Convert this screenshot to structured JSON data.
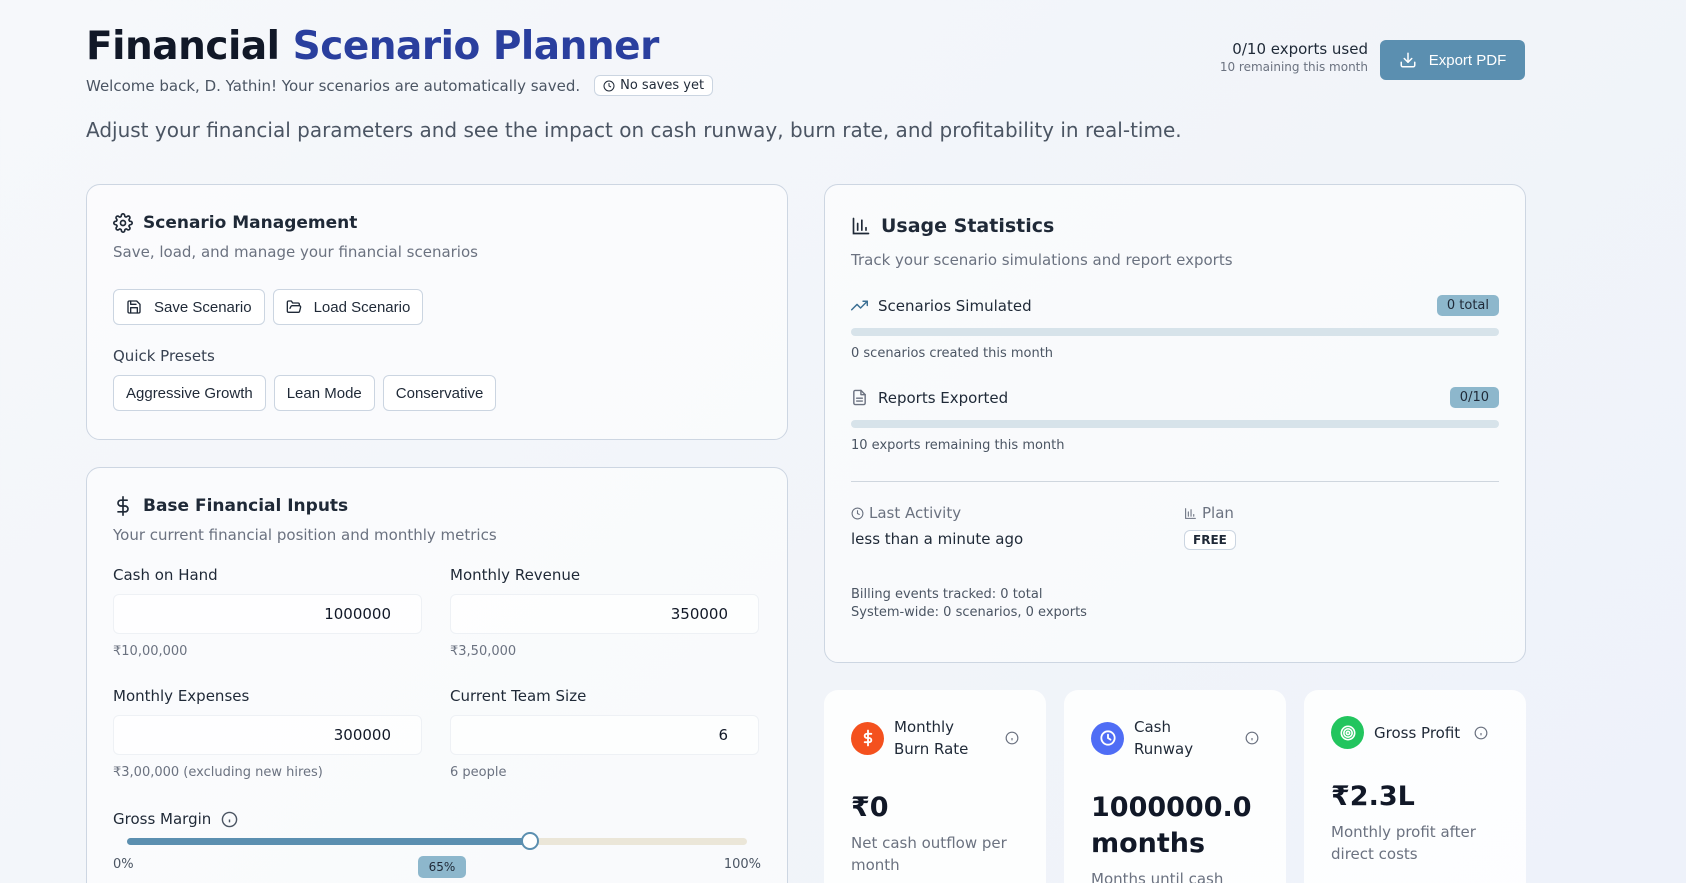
{
  "header": {
    "title_part1": "Financial",
    "title_part2": "Scenario Planner",
    "welcome": "Welcome back, D. Yathin! Your scenarios are automatically saved.",
    "save_status": "No saves yet",
    "lead": "Adjust your financial parameters and see the impact on cash runway, burn rate, and profitability in real-time.",
    "exports_used": "0/10 exports used",
    "exports_remaining": "10 remaining this month",
    "export_button": "Export PDF"
  },
  "scenario": {
    "title": "Scenario Management",
    "desc": "Save, load, and manage your financial scenarios",
    "save_button": "Save Scenario",
    "load_button": "Load Scenario",
    "presets_label": "Quick Presets",
    "presets": [
      "Aggressive Growth",
      "Lean Mode",
      "Conservative"
    ]
  },
  "base_inputs": {
    "title": "Base Financial Inputs",
    "desc": "Your current financial position and monthly metrics",
    "cash": {
      "label": "Cash on Hand",
      "value": "1000000",
      "note": "₹10,00,000"
    },
    "revenue": {
      "label": "Monthly Revenue",
      "value": "350000",
      "note": "₹3,50,000"
    },
    "expenses": {
      "label": "Monthly Expenses",
      "value": "300000",
      "note": "₹3,00,000 (excluding new hires)"
    },
    "team": {
      "label": "Current Team Size",
      "value": "6",
      "note": "6 people"
    },
    "gross_margin": {
      "label": "Gross Margin",
      "min": "0%",
      "max": "100%",
      "value_label": "65%",
      "value": 65
    }
  },
  "usage": {
    "title": "Usage Statistics",
    "desc": "Track your scenario simulations and report exports",
    "scenarios": {
      "label": "Scenarios Simulated",
      "badge": "0 total",
      "note": "0 scenarios created this month",
      "progress": 0
    },
    "reports": {
      "label": "Reports Exported",
      "badge": "0/10",
      "note": "10 exports remaining this month",
      "progress": 0
    },
    "last_activity_label": "Last Activity",
    "last_activity_value": "less than a minute ago",
    "plan_label": "Plan",
    "plan_value": "FREE",
    "billing_line1": "Billing events tracked: 0 total",
    "billing_line2": "System-wide: 0 scenarios, 0 exports"
  },
  "metrics": [
    {
      "name": "Monthly Burn Rate",
      "value": "₹0",
      "note": "Net cash outflow per month",
      "color": "#f4511e"
    },
    {
      "name": "Cash Runway",
      "value": "1000000.0 months",
      "note": "Months until cash runs",
      "color": "#4f6df5"
    },
    {
      "name": "Gross Profit",
      "value": "₹2.3L",
      "note": "Monthly profit after direct costs",
      "color": "#22c55e"
    }
  ],
  "colors": {
    "accent": "#2a3f9e",
    "button": "#5b8fb0",
    "badge": "#8db7cc"
  }
}
